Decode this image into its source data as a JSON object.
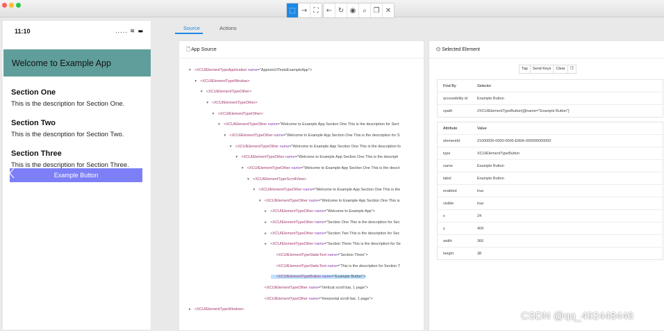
{
  "window": {
    "toolbar_icons": [
      "select-icon",
      "swipe-icon",
      "tap-by-coordinates-icon",
      "back-icon",
      "refresh-icon",
      "eye-icon",
      "search-icon",
      "copy-icon",
      "close-icon"
    ],
    "toolbar_glyphs": [
      "⬚",
      "→",
      "⛶",
      "←",
      "↻",
      "◉",
      "⌕",
      "❐",
      "✕"
    ]
  },
  "device": {
    "time": "11:10",
    "status_icons": "..... ≋ ▬",
    "app_title": "Welcome to Example App",
    "sections": [
      {
        "title": "Section One",
        "description": "This is the description for Section One."
      },
      {
        "title": "Section Two",
        "description": "This is the description for Section Two."
      },
      {
        "title": "Section Three",
        "description": "This is the description for Section Three."
      }
    ],
    "button_label": "Example Button",
    "colors": {
      "appbar": "#5f9e9a",
      "button": "#7d7ff7"
    }
  },
  "tabs": {
    "source": "Source",
    "actions": "Actions"
  },
  "source_panel": {
    "title": "App Source",
    "nodes": [
      {
        "arrow": "▾",
        "tag": "<XCUIElementTypeApplication",
        "attr": "name",
        "value": "=\"AppiumUITestsExampleApp\">"
      },
      {
        "arrow": "▾",
        "tag": "<XCUIElementTypeWindow>",
        "attr": "",
        "value": ""
      },
      {
        "arrow": "▾",
        "tag": "<XCUIElementTypeOther>",
        "attr": "",
        "value": ""
      },
      {
        "arrow": "▾",
        "tag": "<XCUIElementTypeOther>",
        "attr": "",
        "value": ""
      },
      {
        "arrow": "▾",
        "tag": "<XCUIElementTypeOther>",
        "attr": "",
        "value": ""
      },
      {
        "arrow": "▾",
        "tag": "<XCUIElementTypeOther",
        "attr": "name",
        "value": "=\"Welcome to Example App Section One This is the description for Sect"
      },
      {
        "arrow": "▾",
        "tag": "<XCUIElementTypeOther",
        "attr": "name",
        "value": "=\"Welcome to Example App Section One This is the description for S"
      },
      {
        "arrow": "▾",
        "tag": "<XCUIElementTypeOther",
        "attr": "name",
        "value": "=\"Welcome to Example App Section One This is the description fo"
      },
      {
        "arrow": "▾",
        "tag": "<XCUIElementTypeOther",
        "attr": "name",
        "value": "=\"Welcome to Example App Section One This is the descripti"
      },
      {
        "arrow": "▾",
        "tag": "<XCUIElementTypeOther",
        "attr": "name",
        "value": "=\"Welcome to Example App Section One This is the descri"
      },
      {
        "arrow": "▾",
        "tag": "<XCUIElementTypeScrollView>",
        "attr": "",
        "value": ""
      },
      {
        "arrow": "▾",
        "tag": "<XCUIElementTypeOther",
        "attr": "name",
        "value": "=\"Welcome to Example App Section One This is the"
      },
      {
        "arrow": "▾",
        "tag": "<XCUIElementTypeOther",
        "attr": "name",
        "value": "=\"Welcome to Example App Section One This is"
      },
      {
        "arrow": "▸",
        "tag": "<XCUIElementTypeOther",
        "attr": "name",
        "value": "=\"Welcome to Example App\">"
      },
      {
        "arrow": "▸",
        "tag": "<XCUIElementTypeOther",
        "attr": "name",
        "value": "=\"Section One This is the description for Sec"
      },
      {
        "arrow": "▸",
        "tag": "<XCUIElementTypeOther",
        "attr": "name",
        "value": "=\"Section Two This is the description for Sec"
      },
      {
        "arrow": "▸",
        "tag": "<XCUIElementTypeOther",
        "attr": "name",
        "value": "=\"Section Three This is the description for Se"
      },
      {
        "arrow": "",
        "tag": "<XCUIElementTypeStaticText",
        "attr": "name",
        "value": "=\"Section Three\">"
      },
      {
        "arrow": "",
        "tag": "<XCUIElementTypeStaticText",
        "attr": "name",
        "value": "=\"This is the description for Section T"
      },
      {
        "arrow": "",
        "tag": "<XCUIElementTypeButton",
        "attr": "name",
        "value": "=\"Example Button\">"
      },
      {
        "arrow": "",
        "tag": "<XCUIElementTypeOther",
        "attr": "name",
        "value": "=\"Vertical scroll bar, 1 page\">"
      },
      {
        "arrow": "",
        "tag": "<XCUIElementTypeOther",
        "attr": "name",
        "value": "=\"Horizontal scroll bar, 1 page\">"
      },
      {
        "arrow": "▸",
        "tag": "<XCUIElementTypeWindow>",
        "attr": "",
        "value": ""
      }
    ]
  },
  "selected_panel": {
    "title": "Selected Element",
    "actions": [
      "Tap",
      "Send Keys",
      "Clear",
      "❐"
    ],
    "find_by": {
      "headers": [
        "Find By",
        "Selector"
      ],
      "rows": [
        [
          "accessibility id",
          "Example Button"
        ],
        [
          "xpath",
          "//XCUIElementTypeButton[@name=\"Example Button\"]"
        ]
      ]
    },
    "attributes": {
      "headers": [
        "Attribute",
        "Value"
      ],
      "rows": [
        [
          "elementId",
          "21000000-0000-0000-E89A-000000000000"
        ],
        [
          "type",
          "XCUIElementTypeButton"
        ],
        [
          "name",
          "Example Button"
        ],
        [
          "label",
          "Example Button"
        ],
        [
          "enabled",
          "true"
        ],
        [
          "visible",
          "true"
        ],
        [
          "x",
          "24"
        ],
        [
          "y",
          "409"
        ],
        [
          "width",
          "366"
        ],
        [
          "height",
          "38"
        ]
      ]
    }
  },
  "watermark": "CSDN @qq_492448446"
}
